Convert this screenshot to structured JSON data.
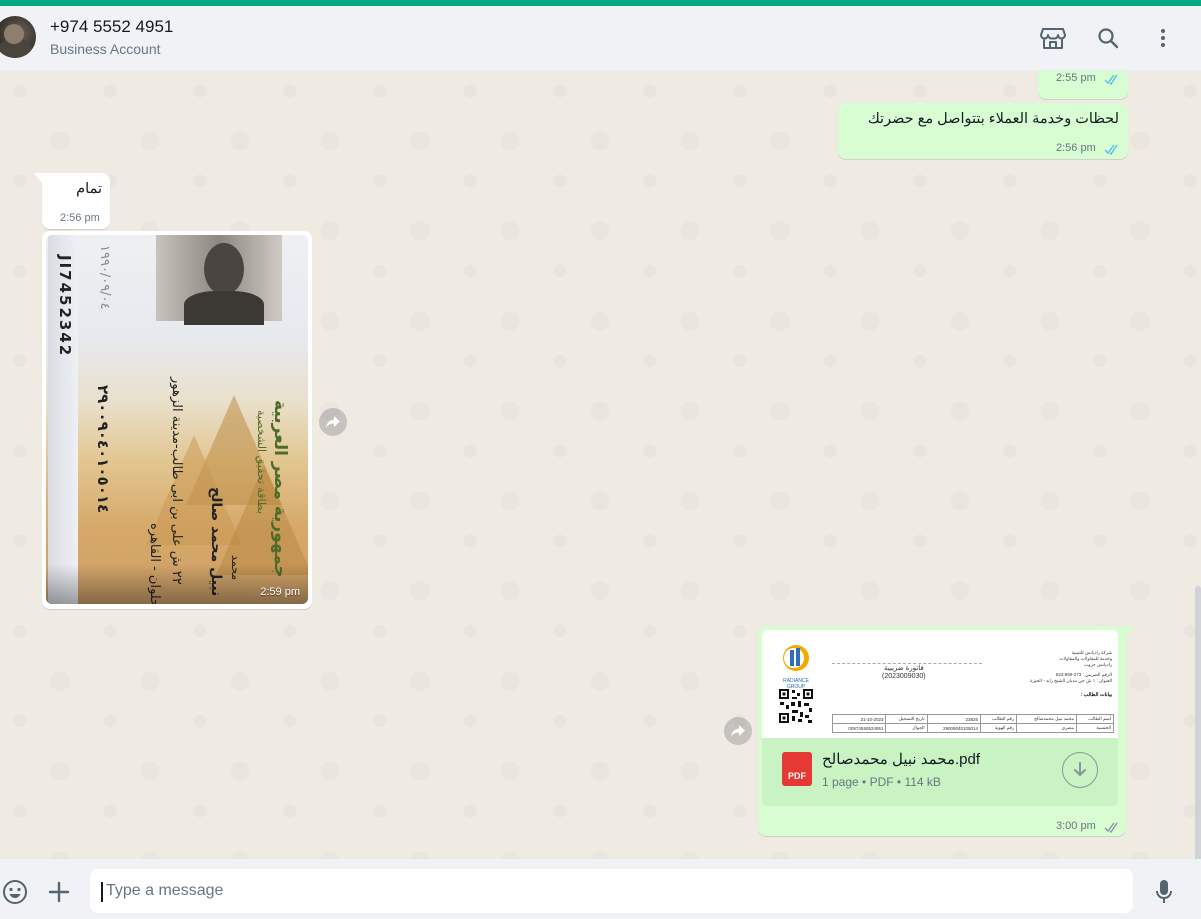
{
  "header": {
    "contact_name": "+974 5552 4951",
    "contact_subtitle": "Business Account",
    "icons": [
      "shop-icon",
      "search-icon",
      "menu-icon"
    ]
  },
  "messages": [
    {
      "direction": "out",
      "text": "",
      "time": "2:55 pm",
      "status": "read"
    },
    {
      "direction": "out",
      "text": "لحظات وخدمة العملاء بتتواصل مع حضرتك",
      "time": "2:56 pm",
      "status": "read"
    },
    {
      "direction": "in",
      "text": "تمام",
      "time": "2:56 pm"
    },
    {
      "direction": "in",
      "type": "image",
      "time": "2:59 pm",
      "image_text": {
        "id_number": "JI7452342",
        "card_title": "جمهورية مصر العربية",
        "card_subtitle": "بطاقة تحقيق الشخصية",
        "first_name": "محمد",
        "full_name": "نبيل محمد صالح",
        "address_1": "٢٢ ش على بن ابى طالب-مدينة الزهور",
        "address_2": "حلوان - القاهره",
        "national_id": "٢٩٠٠٩٠٤٠١٠٥٠١٤",
        "birth": "١٩٩٠/٠٩/٠٤"
      }
    },
    {
      "direction": "out",
      "type": "document",
      "time": "3:00 pm",
      "status": "delivered",
      "file_name": "محمد نبيل محمدصالح.pdf",
      "file_meta": "1 page • PDF • 114 kB",
      "file_badge": "PDF",
      "preview": {
        "logo_text": "RADIANCE GROUP",
        "invoice_title": "فاتورة ضريبية",
        "invoice_number": "(2023009030)",
        "company_lines": [
          "شركة راديانس للتنمية",
          "وخدمة للمقاولات والمقاولات",
          "راديانس جروب"
        ],
        "tax_line": "الرقم الضريبي : 273-869-523",
        "address_line": "العنوان : ١ ش حي مديان الشيخ زايد - الجيزة",
        "student_label": "بيانات الطالب :",
        "table_rows": [
          [
            "31-10-2023",
            "تاريخ التسجيل",
            "23825",
            "رقم الطالب",
            "محمد نبيل محمدصالح",
            "أسم الطالب"
          ],
          [
            "00974555524951",
            "الجوال",
            "29009040105014",
            "رقم الهوية",
            "مصري",
            "الجنسية"
          ]
        ]
      }
    }
  ],
  "composer": {
    "placeholder": "Type a message",
    "value": ""
  },
  "colors": {
    "accent": "#00a884",
    "outgoing_bubble": "#d9fdd3",
    "incoming_bubble": "#ffffff",
    "read_ticks": "#53bdeb"
  }
}
